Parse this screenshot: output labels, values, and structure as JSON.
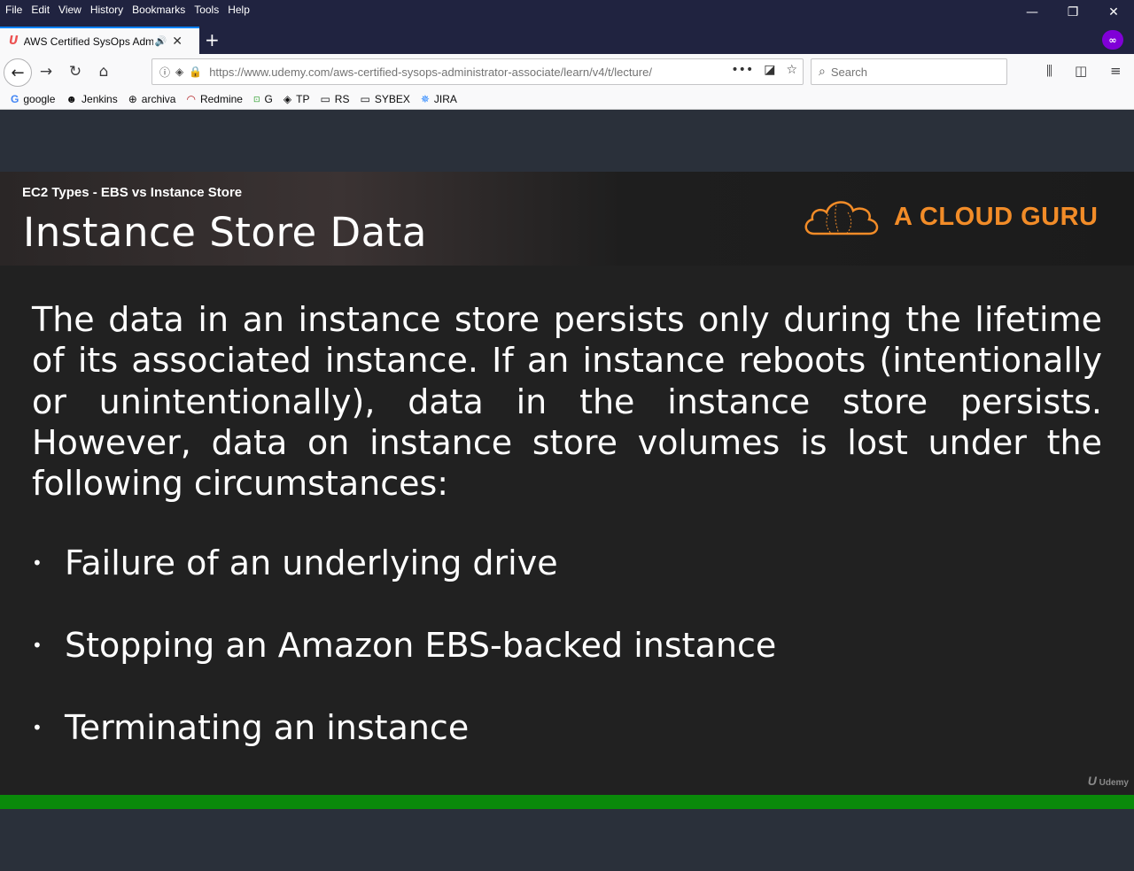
{
  "menu": [
    "File",
    "Edit",
    "View",
    "History",
    "Bookmarks",
    "Tools",
    "Help"
  ],
  "tab": {
    "title": "AWS Certified SysOps Admi",
    "icon": "udemy-icon"
  },
  "window_controls": {
    "minimize": "—",
    "restore": "❐",
    "close": "✕"
  },
  "nav": {
    "url_host": "https://www.udemy.com",
    "url_path": "/aws-certified-sysops-administrator-associate/learn/v4/t/lecture/",
    "search_placeholder": "Search",
    "page_actions": "•••"
  },
  "bookmarks": [
    {
      "label": "google",
      "icon": "google-icon"
    },
    {
      "label": "Jenkins",
      "icon": "jenkins-icon"
    },
    {
      "label": "archiva",
      "icon": "globe-icon"
    },
    {
      "label": "Redmine",
      "icon": "redmine-icon"
    },
    {
      "label": "G",
      "icon": "g-bookmark-icon"
    },
    {
      "label": "TP",
      "icon": "diamond-icon"
    },
    {
      "label": "RS",
      "icon": "folder-icon"
    },
    {
      "label": "SYBEX",
      "icon": "folder-icon"
    },
    {
      "label": "JIRA",
      "icon": "jira-icon"
    }
  ],
  "slide": {
    "subtitle": "EC2 Types - EBS vs Instance Store",
    "title": "Instance Store Data",
    "brand": "A CLOUD GURU",
    "paragraph": "The data in an instance store persists only during the lifetime of its associated instance. If an instance reboots (intentionally or unintentionally), data in the instance store persists. However, data on instance store volumes is lost under the following circumstances:",
    "bullets": [
      "Failure of an underlying drive",
      "Stopping an Amazon EBS-backed instance",
      "Terminating an instance"
    ],
    "watermark": "Udemy"
  },
  "colors": {
    "brand": "#f28c28",
    "progress": "#0a8a0a",
    "private": "#8000d7"
  }
}
